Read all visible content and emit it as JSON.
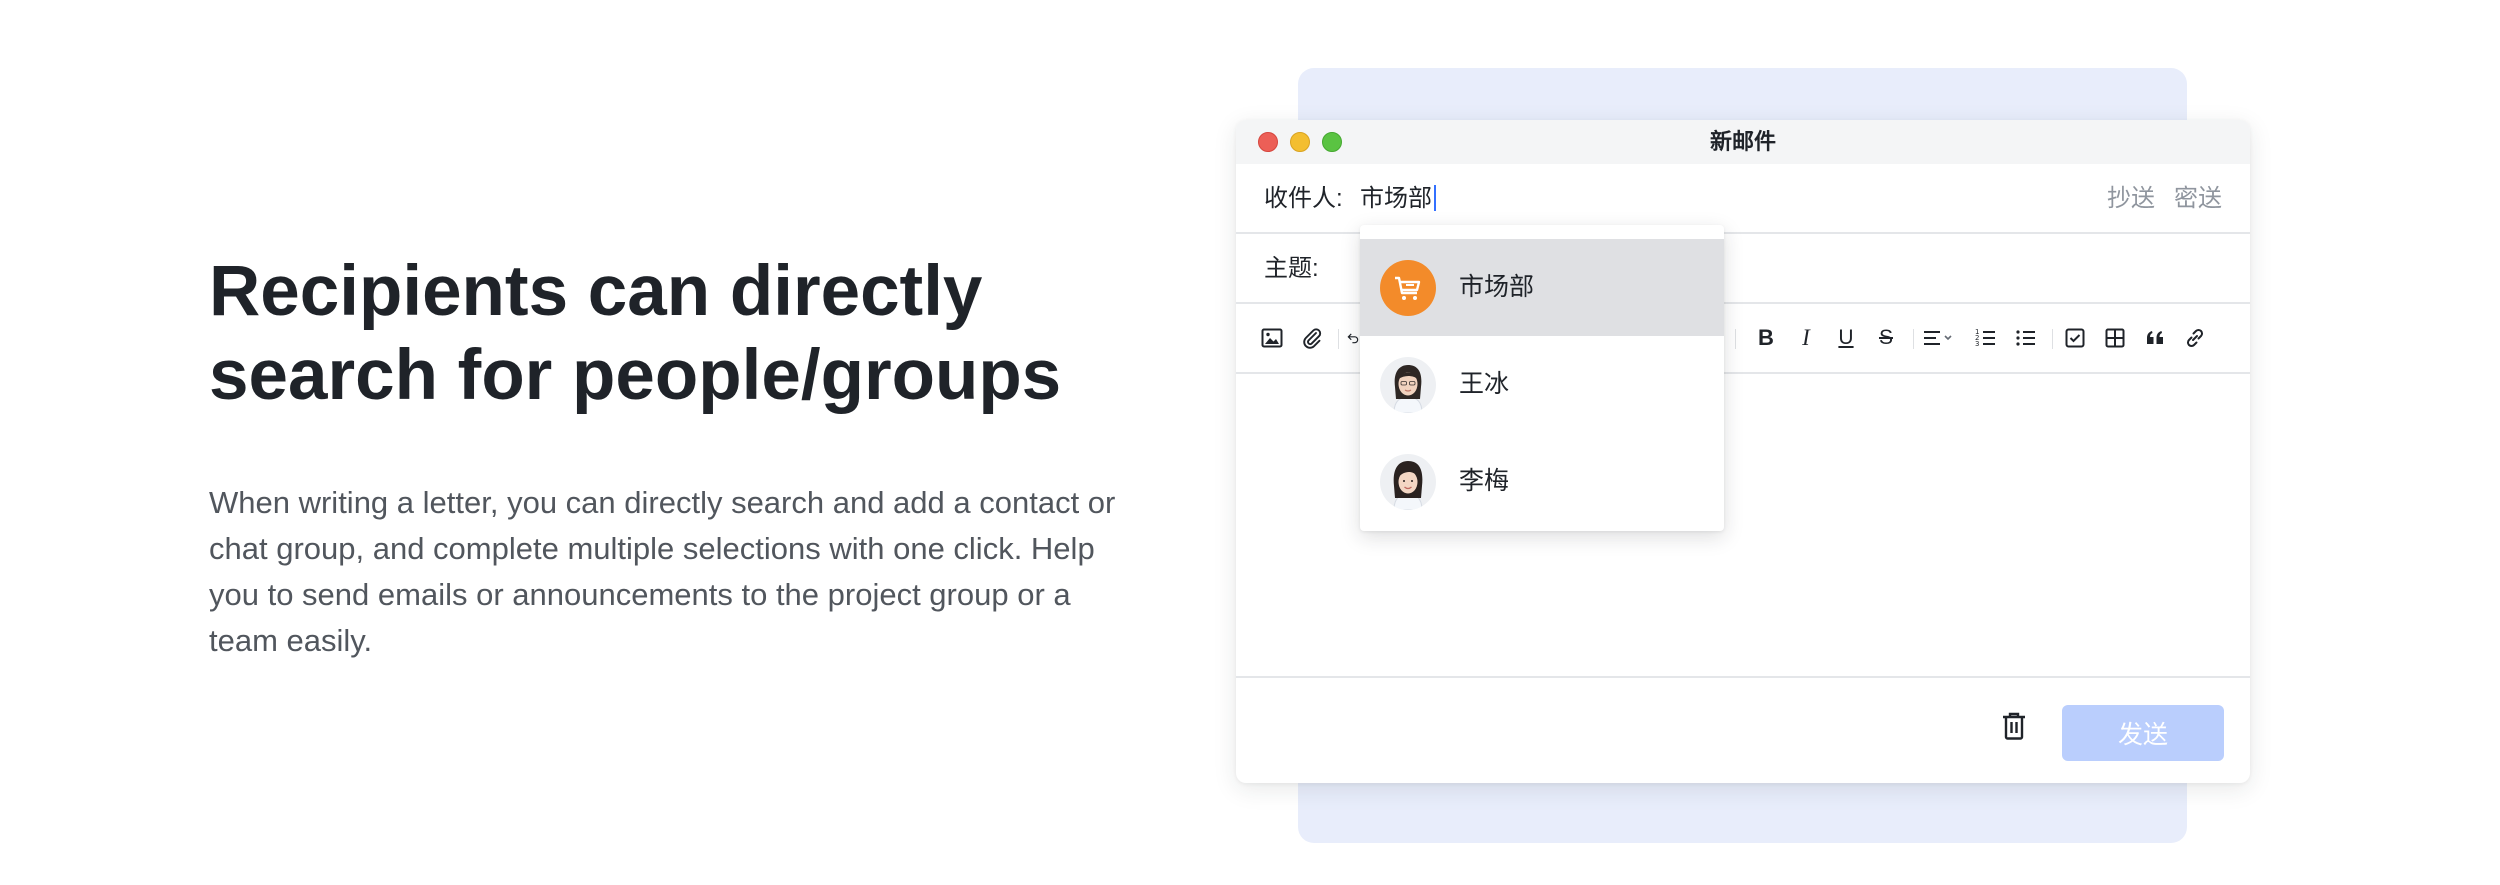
{
  "marketing": {
    "headline_line1": "Recipients can directly",
    "headline_line2": "search for people/groups",
    "description": "When writing a letter, you can directly search and add a contact or chat group, and complete multiple selections with one click. Help you to send emails or announcements to the project group or a team easily."
  },
  "window": {
    "title": "新邮件"
  },
  "compose": {
    "to_label": "收件人:",
    "to_value": "市场部",
    "cc_label": "抄送",
    "bcc_label": "密送",
    "subject_label": "主题:",
    "subject_value": ""
  },
  "toolbar": {
    "icons": [
      "image-icon",
      "attachment-icon",
      "undo-icon",
      "heading-icon",
      "bold-icon",
      "italic-icon",
      "underline-icon",
      "strikethrough-icon",
      "align-icon",
      "ordered-list-icon",
      "bullet-list-icon",
      "checklist-icon",
      "table-icon",
      "quote-icon",
      "link-icon"
    ],
    "bold_glyph": "B",
    "italic_glyph": "I",
    "underline_glyph": "U",
    "strike_glyph": "S"
  },
  "footer": {
    "send_label": "发送"
  },
  "suggestions": [
    {
      "name": "市场部",
      "type": "group",
      "icon": "cart-icon",
      "avatar_color": "#f38b2a",
      "active": true
    },
    {
      "name": "王冰",
      "type": "person",
      "active": false
    },
    {
      "name": "李梅",
      "type": "person",
      "active": false
    }
  ],
  "colors": {
    "accent": "#3370ff",
    "send_disabled": "#bacefd",
    "backdrop": "#e8edfb",
    "group_avatar": "#f38b2a"
  }
}
